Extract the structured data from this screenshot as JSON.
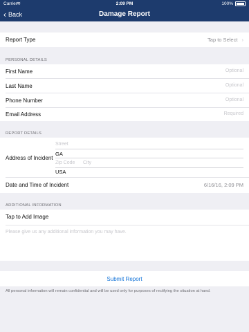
{
  "status_bar": {
    "carrier": "Carrier",
    "time": "2:09 PM",
    "battery": "100%"
  },
  "nav": {
    "back_label": "Back",
    "title": "Damage Report"
  },
  "report_type": {
    "label": "Report Type",
    "value": "Tap to Select"
  },
  "personal": {
    "header": "PERSONAL DETAILS",
    "first_name": {
      "label": "First Name",
      "placeholder": "Optional"
    },
    "last_name": {
      "label": "Last Name",
      "placeholder": "Optional"
    },
    "phone": {
      "label": "Phone Number",
      "placeholder": "Optional"
    },
    "email": {
      "label": "Email Address",
      "placeholder": "Required"
    }
  },
  "report": {
    "header": "REPORT DETAILS",
    "address_label": "Address of Incident",
    "street_placeholder": "Street",
    "state": "GA",
    "zip_placeholder": "Zip Code",
    "city_placeholder": "City",
    "country": "USA",
    "datetime_label": "Date and Time of Incident",
    "datetime_value": "6/16/16, 2:09 PM"
  },
  "additional": {
    "header": "ADDITIONAL INFORMATION",
    "add_image": "Tap to Add Image",
    "notes_placeholder": "Please give us any additional information you may have."
  },
  "submit_label": "Submit Report",
  "footnote": "All personal information will remain confidential and will be used only for purposes of rectifying the situation at hand."
}
